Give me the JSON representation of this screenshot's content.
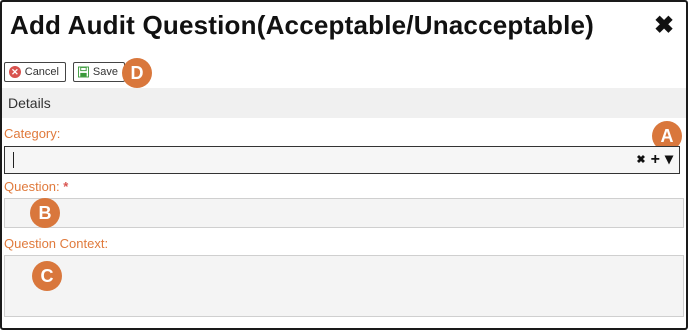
{
  "dialog": {
    "title": "Add Audit Question(Acceptable/Unacceptable)",
    "close_glyph": "✖"
  },
  "toolbar": {
    "cancel_label": "Cancel",
    "save_label": "Save"
  },
  "section": {
    "details_label": "Details"
  },
  "fields": {
    "category_label": "Category:",
    "question_label": "Question:",
    "question_required": "*",
    "question_context_label": "Question Context:"
  },
  "combo_icons": {
    "clear": "✖",
    "add": "+",
    "dropdown": "▾"
  },
  "callouts": {
    "a": "A",
    "b": "B",
    "c": "C",
    "d": "D"
  },
  "colors": {
    "accent_label": "#e07a3c",
    "callout": "#d9773c",
    "cancel_icon": "#d9534f",
    "save_icon": "#3a9a3a"
  }
}
